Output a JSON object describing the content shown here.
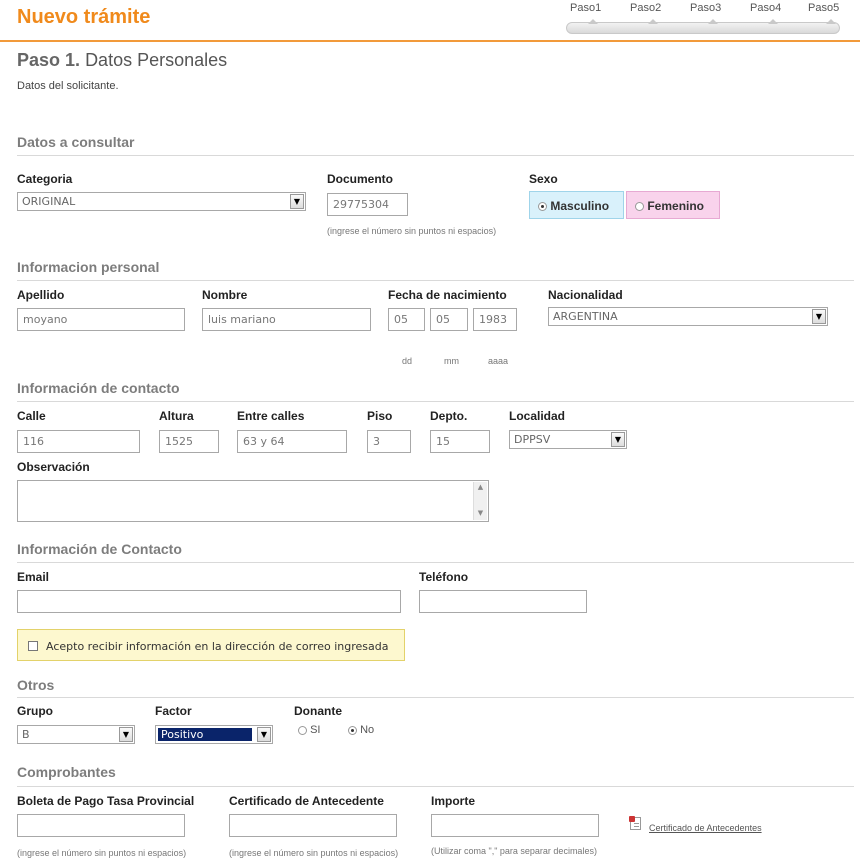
{
  "header": {
    "title": "Nuevo trámite",
    "steps": [
      "Paso1",
      "Paso2",
      "Paso3",
      "Paso4",
      "Paso5"
    ]
  },
  "step": {
    "number": "Paso 1.",
    "name": "Datos Personales",
    "subtitle": "Datos del solicitante."
  },
  "consultar": {
    "heading": "Datos a consultar",
    "categoria_label": "Categoria",
    "categoria_value": "ORIGINAL",
    "documento_label": "Documento",
    "documento_value": "29775304",
    "documento_hint": "(ingrese el número sin puntos ni espacios)",
    "sexo_label": "Sexo",
    "sexo_options": [
      "Masculino",
      "Femenino"
    ],
    "sexo_selected": "Masculino"
  },
  "personal": {
    "heading": "Informacion personal",
    "apellido_label": "Apellido",
    "apellido_value": "moyano",
    "nombre_label": "Nombre",
    "nombre_value": "luis mariano",
    "fecha_label": "Fecha de nacimiento",
    "fecha_dd": "05",
    "fecha_mm": "05",
    "fecha_aaaa": "1983",
    "hint_dd": "dd",
    "hint_mm": "mm",
    "hint_aaaa": "aaaa",
    "nacionalidad_label": "Nacionalidad",
    "nacionalidad_value": "ARGENTINA"
  },
  "contacto": {
    "heading": "Información de contacto",
    "calle_label": "Calle",
    "calle_value": "116",
    "altura_label": "Altura",
    "altura_value": "1525",
    "entre_label": "Entre calles",
    "entre_value": "63 y 64",
    "piso_label": "Piso",
    "piso_value": "3",
    "depto_label": "Depto.",
    "depto_value": "15",
    "localidad_label": "Localidad",
    "localidad_value": "DPPSV",
    "observacion_label": "Observación"
  },
  "contacto2": {
    "heading": "Información de Contacto",
    "email_label": "Email",
    "email_value": "",
    "telefono_label": "Teléfono",
    "telefono_value": "",
    "acepto_text": "Acepto recibir información en la dirección de correo ingresada"
  },
  "otros": {
    "heading": "Otros",
    "grupo_label": "Grupo",
    "grupo_value": "B",
    "factor_label": "Factor",
    "factor_value": "Positivo",
    "donante_label": "Donante",
    "donante_options": [
      "SI",
      "No"
    ],
    "donante_selected": "No"
  },
  "comprobantes": {
    "heading": "Comprobantes",
    "boleta_label": "Boleta de Pago Tasa Provincial",
    "boleta_hint": "(ingrese el número sin puntos ni espacios)",
    "cert_label": "Certificado de Antecedente",
    "cert_hint": "(ingrese el número sin puntos ni espacios)",
    "importe_label": "Importe",
    "importe_hint": "(Utilizar coma \",\" para separar decimales)",
    "cert_link": "Certificado de Antecedentes"
  },
  "icons": {
    "select_arrow": "chevron-down-icon",
    "document": "document-icon"
  },
  "colors": {
    "accent": "#f08a1c",
    "masculino_bg": "#d9f1fb",
    "femenino_bg": "#f9d3ec",
    "notice_bg": "#fdf8cf",
    "factor_bg": "#0a246a"
  }
}
